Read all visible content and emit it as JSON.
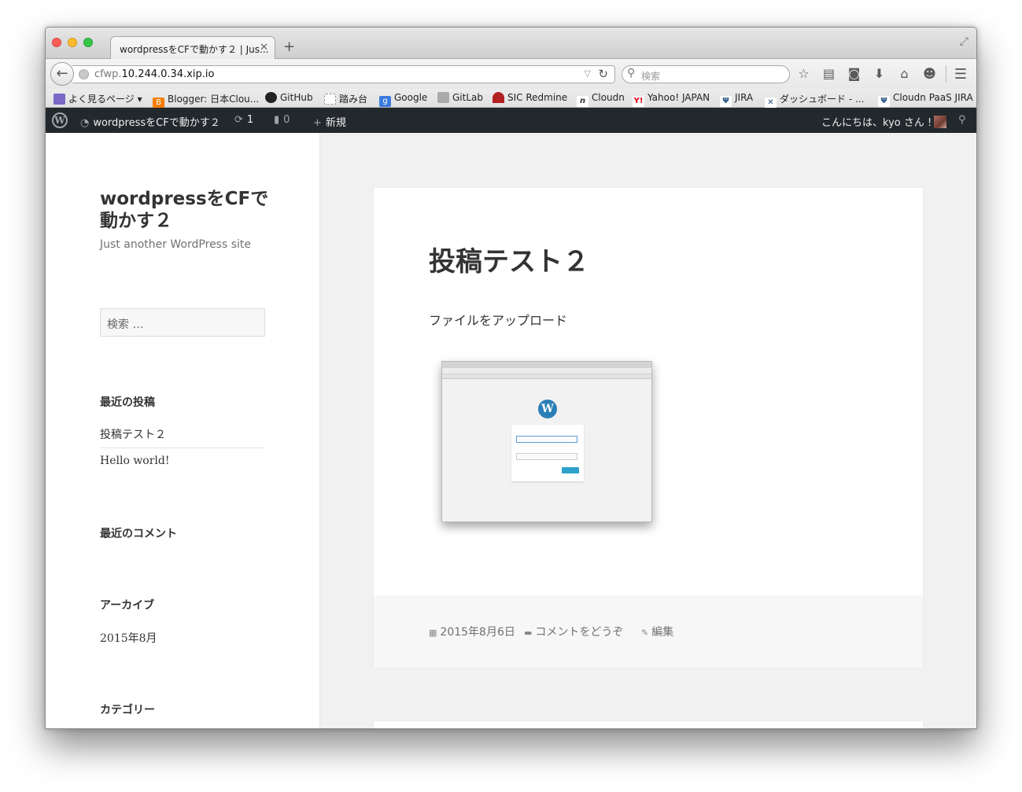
{
  "browser": {
    "tab_title": "wordpressをCFで動かす２ | Jus...",
    "tab_close": "✕",
    "new_tab": "+",
    "url_prefix": "cfwp.",
    "url_host": "10.244.0.34.xip.io",
    "search_placeholder": "検索"
  },
  "bookmarks": [
    {
      "label": "よく見るページ ▾",
      "icon": "folder-icon",
      "color": "#7b67c5"
    },
    {
      "label": "Blogger: 日本Clou...",
      "icon": "blogger-icon",
      "color": "#f57d00"
    },
    {
      "label": "GitHub",
      "icon": "github-icon",
      "color": "#222222"
    },
    {
      "label": "踏み台",
      "icon": "page-icon",
      "color": "#cccccc"
    },
    {
      "label": "Google",
      "icon": "google-icon",
      "color": "#3b7be0"
    },
    {
      "label": "GitLab",
      "icon": "gitlab-icon",
      "color": "#888888"
    },
    {
      "label": "SIC Redmine",
      "icon": "redmine-icon",
      "color": "#b32024"
    },
    {
      "label": "Cloudn",
      "icon": "cloudn-icon",
      "color": "#333333"
    },
    {
      "label": "Yahoo! JAPAN",
      "icon": "yahoo-icon",
      "color": "#e60012"
    },
    {
      "label": "JIRA",
      "icon": "jira-icon",
      "color": "#205081"
    },
    {
      "label": "ダッシュボード - ...",
      "icon": "dashboard-icon",
      "color": "#205081"
    },
    {
      "label": "Cloudn PaaS JIRA",
      "icon": "jira-icon",
      "color": "#205081"
    }
  ],
  "adminbar": {
    "site_name": "wordpressをCFで動かす２",
    "updates": "1",
    "comments": "0",
    "new_label": "新規",
    "greeting": "こんにちは、kyo さん !"
  },
  "sidebar": {
    "site_title": "wordpressをCFで動かす２",
    "site_description": "Just another WordPress site",
    "search_placeholder": "検索 …",
    "recent_posts_title": "最近の投稿",
    "recent_posts": [
      "投稿テスト２",
      "Hello world!"
    ],
    "recent_comments_title": "最近のコメント",
    "archives_title": "アーカイブ",
    "archives": [
      "2015年8月"
    ],
    "categories_title": "カテゴリー"
  },
  "post": {
    "title": "投稿テスト２",
    "content": "ファイルをアップロード",
    "date": "2015年8月6日",
    "comment_link": "コメントをどうぞ",
    "edit_link": "編集"
  }
}
